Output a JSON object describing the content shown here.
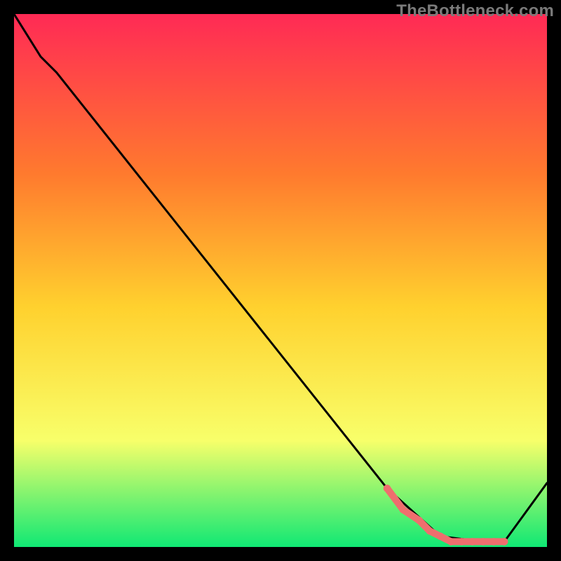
{
  "watermark": "TheBottleneck.com",
  "chart_data": {
    "type": "line",
    "title": "",
    "xlabel": "",
    "ylabel": "",
    "xlim": [
      0,
      100
    ],
    "ylim": [
      0,
      100
    ],
    "grid": false,
    "legend": false,
    "background_gradient": {
      "top": "#ff2a55",
      "upper": "#ff7a2e",
      "mid": "#ffd12e",
      "lower": "#f8ff6a",
      "bottom": "#10e874"
    },
    "series": [
      {
        "name": "bottleneck-curve",
        "color": "#000000",
        "x": [
          0,
          5,
          8,
          70,
          80,
          88,
          92,
          100
        ],
        "values": [
          100,
          92,
          89,
          11,
          2,
          1,
          1,
          12
        ]
      }
    ],
    "highlight_band": {
      "name": "optimal-range",
      "color": "#ef6e6e",
      "marker_radius_frac": 0.007,
      "x": [
        70,
        73,
        76,
        78,
        80,
        82,
        84,
        86,
        88,
        90,
        92
      ],
      "values": [
        11,
        7,
        5,
        3,
        2,
        1,
        1,
        1,
        1,
        1,
        1
      ]
    }
  }
}
